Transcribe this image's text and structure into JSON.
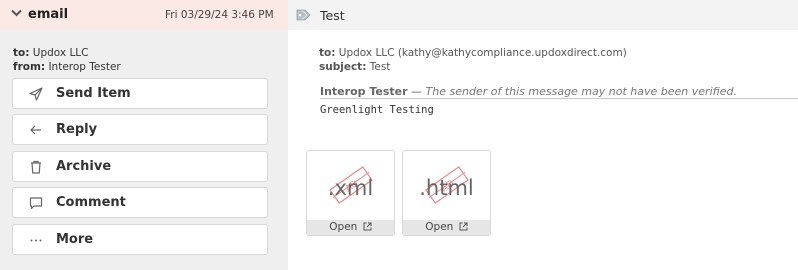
{
  "header": {
    "folder_label": "email",
    "date": "Fri 03/29/24 3:46 PM",
    "subject_title": "Test"
  },
  "left_meta": {
    "to_label": "to:",
    "to_value": "Updox LLC",
    "from_label": "from:",
    "from_value": "Interop Tester"
  },
  "actions": [
    {
      "label": "Send Item",
      "icon": "send-icon"
    },
    {
      "label": "Reply",
      "icon": "arrow-left-icon"
    },
    {
      "label": "Archive",
      "icon": "trash-icon"
    },
    {
      "label": "Comment",
      "icon": "comment-icon"
    },
    {
      "label": "More",
      "icon": "ellipsis-icon"
    }
  ],
  "message": {
    "to_label": "to:",
    "to_value": "Updox LLC (kathy@kathycompliance.updoxdirect.com)",
    "subject_label": "subject:",
    "subject_value": "Test",
    "sender_name": "Interop Tester",
    "sender_sep": "—",
    "sender_warning": "The sender of this message may not have been verified.",
    "body": "Greenlight Testing"
  },
  "attachments": [
    {
      "ext": ".xml",
      "open_label": "Open"
    },
    {
      "ext": ".html",
      "open_label": "Open"
    }
  ],
  "colors": {
    "header_bg": "#fbe9e6",
    "panel_bg": "#efefef",
    "stamp_red": "#e36b6b"
  }
}
